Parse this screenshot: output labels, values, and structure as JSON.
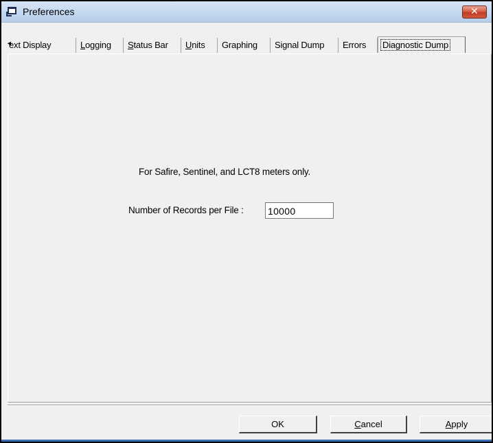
{
  "window": {
    "title": "Preferences",
    "close_glyph": "✕"
  },
  "tabs": [
    {
      "label": "Text Display",
      "display": "ext Display",
      "mnemonic": "T",
      "active": false
    },
    {
      "label": "Logging",
      "mnemonic": "L",
      "active": false
    },
    {
      "label": "Status Bar",
      "mnemonic": "S",
      "active": false
    },
    {
      "label": "Units",
      "mnemonic": "U",
      "active": false
    },
    {
      "label": "Graphing",
      "mnemonic": "",
      "active": false
    },
    {
      "label": "Signal Dump",
      "mnemonic": "",
      "active": false
    },
    {
      "label": "Errors",
      "mnemonic": "",
      "active": false
    },
    {
      "label": "Diagnostic Dump",
      "mnemonic": "",
      "active": true
    }
  ],
  "tab_scroll_icon": "scroll-left-icon",
  "panel": {
    "note": "For Safire, Sentinel, and LCT8 meters only.",
    "records_label": "Number of Records per File :",
    "records_value": "10000"
  },
  "buttons": {
    "ok": "OK",
    "cancel": "Cancel",
    "apply": "Apply"
  }
}
